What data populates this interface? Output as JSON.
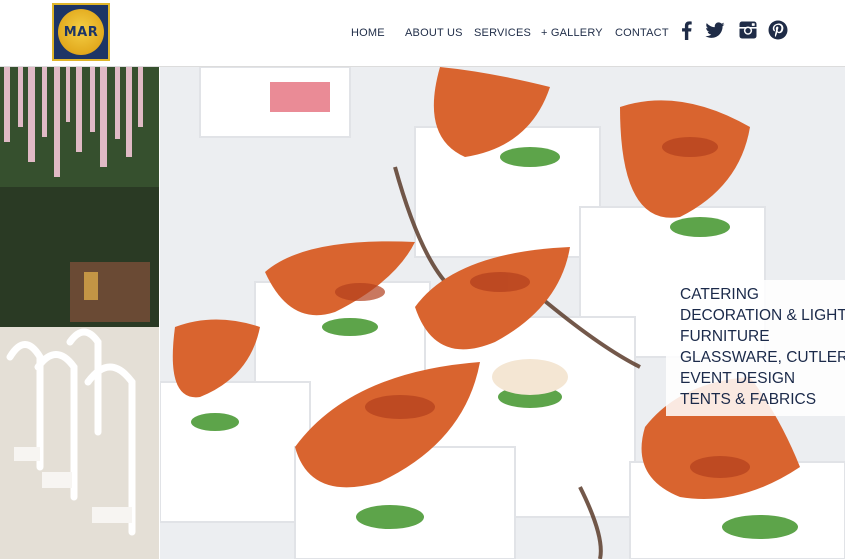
{
  "brand": {
    "logo_text": "MAR"
  },
  "nav": {
    "items": [
      {
        "label": "HOME"
      },
      {
        "label": "ABOUT US"
      },
      {
        "label": "SERVICES"
      },
      {
        "label": "+ GALLERY"
      },
      {
        "label": "CONTACT"
      }
    ]
  },
  "social": [
    {
      "icon": "facebook-icon"
    },
    {
      "icon": "twitter-icon"
    },
    {
      "icon": "instagram-icon"
    },
    {
      "icon": "pinterest-icon"
    }
  ],
  "services": [
    "CATERING",
    "DECORATION & LIGHTING",
    "FURNITURE",
    "GLASSWARE, CUTLERY",
    "EVENT DESIGN",
    "TENTS & FABRICS"
  ],
  "colors": {
    "nav_text": "#1f2c47",
    "logo_bg": "#1d3566",
    "logo_gold": "#e2a91d",
    "services_text": "#1b2a4a"
  }
}
